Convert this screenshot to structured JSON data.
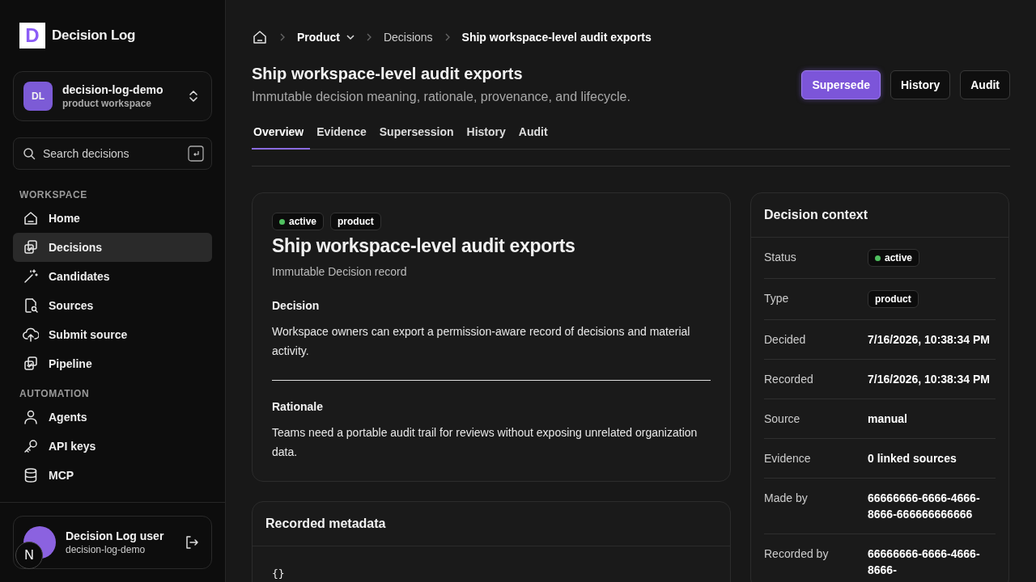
{
  "sidebar": {
    "logo": {
      "letter": "D",
      "name": "Decision Log"
    },
    "workspace": {
      "initials": "DL",
      "name": "decision-log-demo",
      "subtitle": "product workspace"
    },
    "search": {
      "placeholder": "Search decisions"
    },
    "sections": [
      {
        "heading": "WORKSPACE",
        "items": [
          {
            "label": "Home",
            "selected": false
          },
          {
            "label": "Decisions",
            "selected": true
          },
          {
            "label": "Candidates",
            "selected": false
          },
          {
            "label": "Sources",
            "selected": false
          },
          {
            "label": "Submit source",
            "selected": false
          },
          {
            "label": "Pipeline",
            "selected": false
          }
        ]
      },
      {
        "heading": "AUTOMATION",
        "items": [
          {
            "label": "Agents",
            "selected": false
          },
          {
            "label": "API keys",
            "selected": false
          },
          {
            "label": "MCP",
            "selected": false
          }
        ]
      }
    ],
    "user": {
      "name": "Decision Log user",
      "workspace": "decision-log-demo",
      "badge": "N"
    }
  },
  "breadcrumb": [
    {
      "label": "Product",
      "current": false,
      "menu": true
    },
    {
      "label": "Decisions",
      "current": false,
      "menu": false
    },
    {
      "label": "Ship workspace-level audit exports",
      "current": true,
      "menu": false
    }
  ],
  "header": {
    "title": "Ship workspace-level audit exports",
    "subtitle": "Immutable decision meaning, rationale, provenance, and lifecycle.",
    "actions": [
      {
        "label": "Supersede",
        "primary": true
      },
      {
        "label": "History",
        "primary": false
      },
      {
        "label": "Audit",
        "primary": false
      }
    ]
  },
  "tabs": [
    {
      "label": "Overview",
      "selected": true
    },
    {
      "label": "Evidence",
      "selected": false
    },
    {
      "label": "Supersession",
      "selected": false
    },
    {
      "label": "History",
      "selected": false
    },
    {
      "label": "Audit",
      "selected": false
    }
  ],
  "record": {
    "tags": [
      {
        "label": "active",
        "kind": "status",
        "color": "#4fbf5f"
      },
      {
        "label": "product",
        "kind": "type"
      }
    ],
    "title": "Ship workspace-level audit exports",
    "subtitle": "Immutable Decision record",
    "sections": [
      {
        "heading": "Decision",
        "text": "Workspace owners can export a permission-aware record of decisions and material activity."
      },
      {
        "heading": "Rationale",
        "text": "Teams need a portable audit trail for reviews without exposing unrelated organization data."
      }
    ]
  },
  "metadata": {
    "title": "Recorded metadata",
    "code": "{}"
  },
  "context": {
    "title": "Decision context",
    "rows": [
      {
        "label": "Status",
        "value": "active",
        "kind": "status",
        "color": "#4fbf5f"
      },
      {
        "label": "Type",
        "value": "product",
        "kind": "tag"
      },
      {
        "label": "Decided",
        "value": "7/16/2026, 10:38:34 PM",
        "kind": "text"
      },
      {
        "label": "Recorded",
        "value": "7/16/2026, 10:38:34 PM",
        "kind": "text"
      },
      {
        "label": "Source",
        "value": "manual",
        "kind": "text"
      },
      {
        "label": "Evidence",
        "value": "0 linked sources",
        "kind": "text"
      },
      {
        "label": "Made by",
        "value": "66666666-6666-4666-8666-666666666666",
        "kind": "text"
      },
      {
        "label": "Recorded by",
        "value": "66666666-6666-4666-8666-",
        "kind": "text"
      }
    ]
  }
}
